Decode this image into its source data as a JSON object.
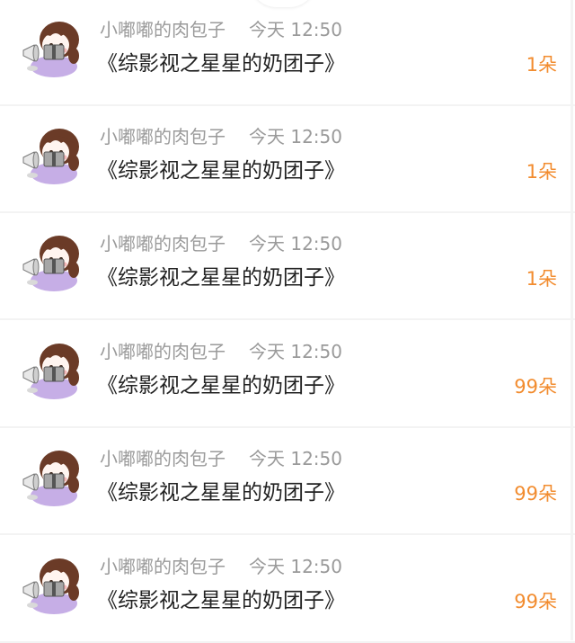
{
  "colors": {
    "meta_text": "#9a9a9a",
    "title_text": "#222222",
    "count_accent": "#f28c2f",
    "avatar_hair": "#6b3b27",
    "avatar_shirt": "#c6aee6",
    "avatar_skin": "#fff5f0"
  },
  "avatar_icon": "girl-with-gift-avatar",
  "rows": [
    {
      "user": "小嘟嘟的肉包子",
      "time": "今天 12:50",
      "title": "《综影视之星星的奶团子》",
      "count": "1朵"
    },
    {
      "user": "小嘟嘟的肉包子",
      "time": "今天 12:50",
      "title": "《综影视之星星的奶团子》",
      "count": "1朵"
    },
    {
      "user": "小嘟嘟的肉包子",
      "time": "今天 12:50",
      "title": "《综影视之星星的奶团子》",
      "count": "1朵"
    },
    {
      "user": "小嘟嘟的肉包子",
      "time": "今天 12:50",
      "title": "《综影视之星星的奶团子》",
      "count": "99朵"
    },
    {
      "user": "小嘟嘟的肉包子",
      "time": "今天 12:50",
      "title": "《综影视之星星的奶团子》",
      "count": "99朵"
    },
    {
      "user": "小嘟嘟的肉包子",
      "time": "今天 12:50",
      "title": "《综影视之星星的奶团子》",
      "count": "99朵"
    }
  ]
}
